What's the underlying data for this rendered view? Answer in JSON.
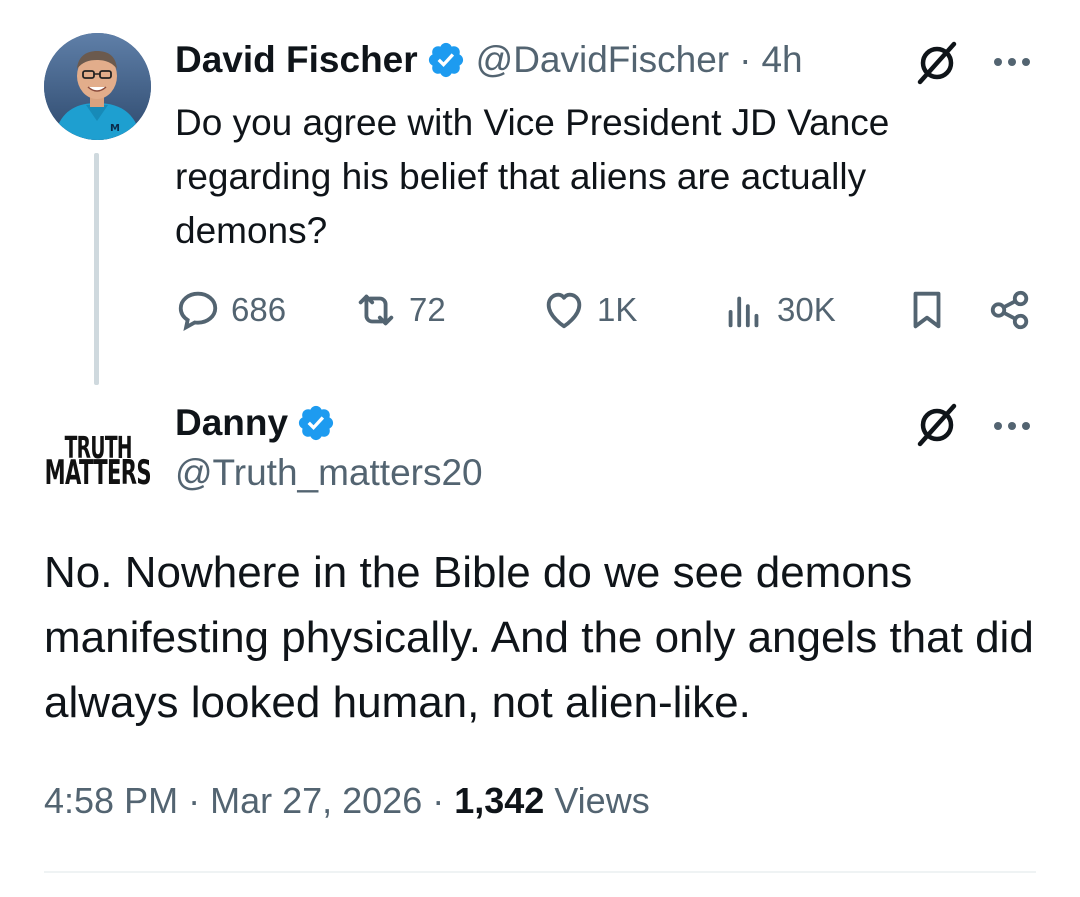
{
  "colors": {
    "verified_badge": "#1d9bf0",
    "text_primary": "#0f1419",
    "text_secondary": "#536471",
    "thread_line": "#cfd9de"
  },
  "parent_tweet": {
    "author_name": "David Fischer",
    "handle": "@DavidFischer",
    "separator": "·",
    "time": "4h",
    "text": "Do you agree with Vice President JD Vance regarding his belief that aliens are actually demons?",
    "actions": {
      "replies": "686",
      "reposts": "72",
      "likes": "1K",
      "views": "30K"
    },
    "icons": {
      "verified": "verified-badge-icon",
      "grok": "grok-icon",
      "more": "more-icon",
      "reply": "reply-icon",
      "repost": "repost-icon",
      "like": "heart-icon",
      "views": "analytics-icon",
      "bookmark": "bookmark-icon",
      "share": "share-icon"
    }
  },
  "reply_tweet": {
    "author_name": "Danny",
    "handle": "@Truth_matters20",
    "avatar_text_line1": "TRUTH",
    "avatar_text_line2": "MATTERS",
    "text": "No. Nowhere in the Bible do we see demons manifesting physically. And the only angels that did always looked human, not alien-like.",
    "time": "4:58 PM",
    "separator1": "·",
    "date": "Mar 27, 2026",
    "separator2": "·",
    "views_count": "1,342",
    "views_label": "Views"
  }
}
